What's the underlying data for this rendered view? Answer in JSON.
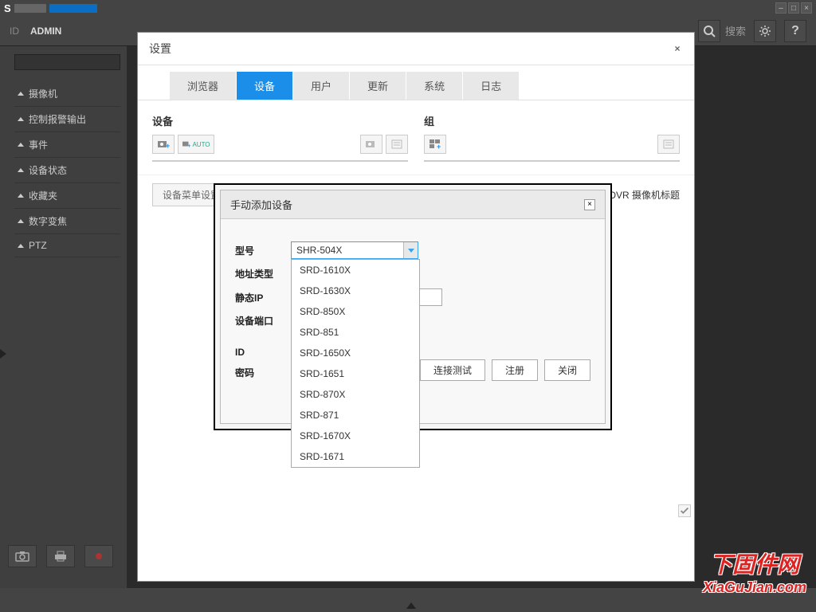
{
  "titlebar": {
    "logo_letter": "S"
  },
  "header": {
    "id_label": "ID",
    "id_value": "ADMIN",
    "search_label": "搜索"
  },
  "sidebar": {
    "items": [
      {
        "label": "摄像机"
      },
      {
        "label": "控制报警输出"
      },
      {
        "label": "事件"
      },
      {
        "label": "设备状态"
      },
      {
        "label": "收藏夹"
      },
      {
        "label": "数字变焦"
      },
      {
        "label": "PTZ"
      }
    ]
  },
  "settings_modal": {
    "title": "设置",
    "tabs": [
      {
        "label": "浏览器",
        "active": false
      },
      {
        "label": "设备",
        "active": true
      },
      {
        "label": "用户",
        "active": false
      },
      {
        "label": "更新",
        "active": false
      },
      {
        "label": "系统",
        "active": false
      },
      {
        "label": "日志",
        "active": false
      }
    ],
    "col_device_title": "设备",
    "col_group_title": "组",
    "auto_label": "AUTO",
    "device_menu_btn": "设备菜单设置",
    "apply_dvr_label": "应用 DVR 摄像机标题"
  },
  "add_modal": {
    "title": "手动添加设备",
    "fields": {
      "model": "型号",
      "addr_type": "地址类型",
      "static_ip": "静态IP",
      "device_port": "设备端口",
      "id": "ID",
      "password": "密码"
    },
    "selected_model": "SHR-504X",
    "dropdown_options": [
      "SRD-1610X",
      "SRD-1630X",
      "SRD-850X",
      "SRD-851",
      "SRD-1650X",
      "SRD-1651",
      "SRD-870X",
      "SRD-871",
      "SRD-1670X",
      "SRD-1671"
    ],
    "actions": {
      "test": "连接测试",
      "register": "注册",
      "close": "关闭"
    }
  },
  "watermark": {
    "line1": "下固件网",
    "line2": "XiaGuJian.com"
  }
}
